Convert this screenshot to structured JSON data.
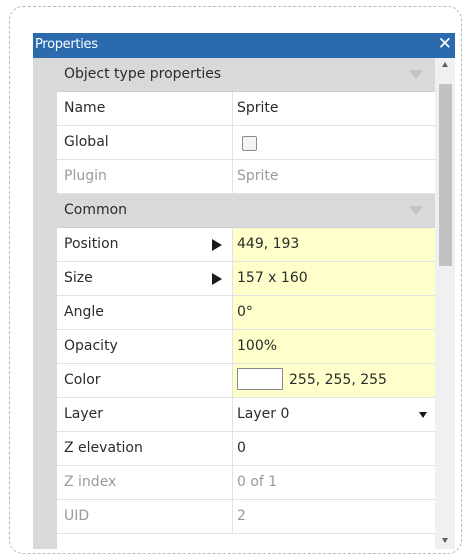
{
  "panel": {
    "title": "Properties",
    "close_glyph": "✕",
    "title_bar_color": "#2b6aad",
    "highlight_color": "#ffffcc"
  },
  "sections": {
    "object_type": {
      "label": "Object type properties",
      "icon": "collapse-arrow-icon"
    },
    "common": {
      "label": "Common",
      "icon": "collapse-arrow-icon"
    }
  },
  "rows": {
    "name": {
      "label": "Name",
      "value": "Sprite"
    },
    "global": {
      "label": "Global",
      "checked": false
    },
    "plugin": {
      "label": "Plugin",
      "value": "Sprite"
    },
    "position": {
      "label": "Position",
      "value": "449, 193"
    },
    "size": {
      "label": "Size",
      "value": "157 x 160"
    },
    "angle": {
      "label": "Angle",
      "value": "0°"
    },
    "opacity": {
      "label": "Opacity",
      "value": "100%"
    },
    "color": {
      "label": "Color",
      "value": "255, 255, 255",
      "swatch": "#ffffff"
    },
    "layer": {
      "label": "Layer",
      "value": "Layer 0"
    },
    "z_elevation": {
      "label": "Z elevation",
      "value": "0"
    },
    "z_index": {
      "label": "Z index",
      "value": "0 of 1"
    },
    "uid": {
      "label": "UID",
      "value": "2"
    }
  }
}
